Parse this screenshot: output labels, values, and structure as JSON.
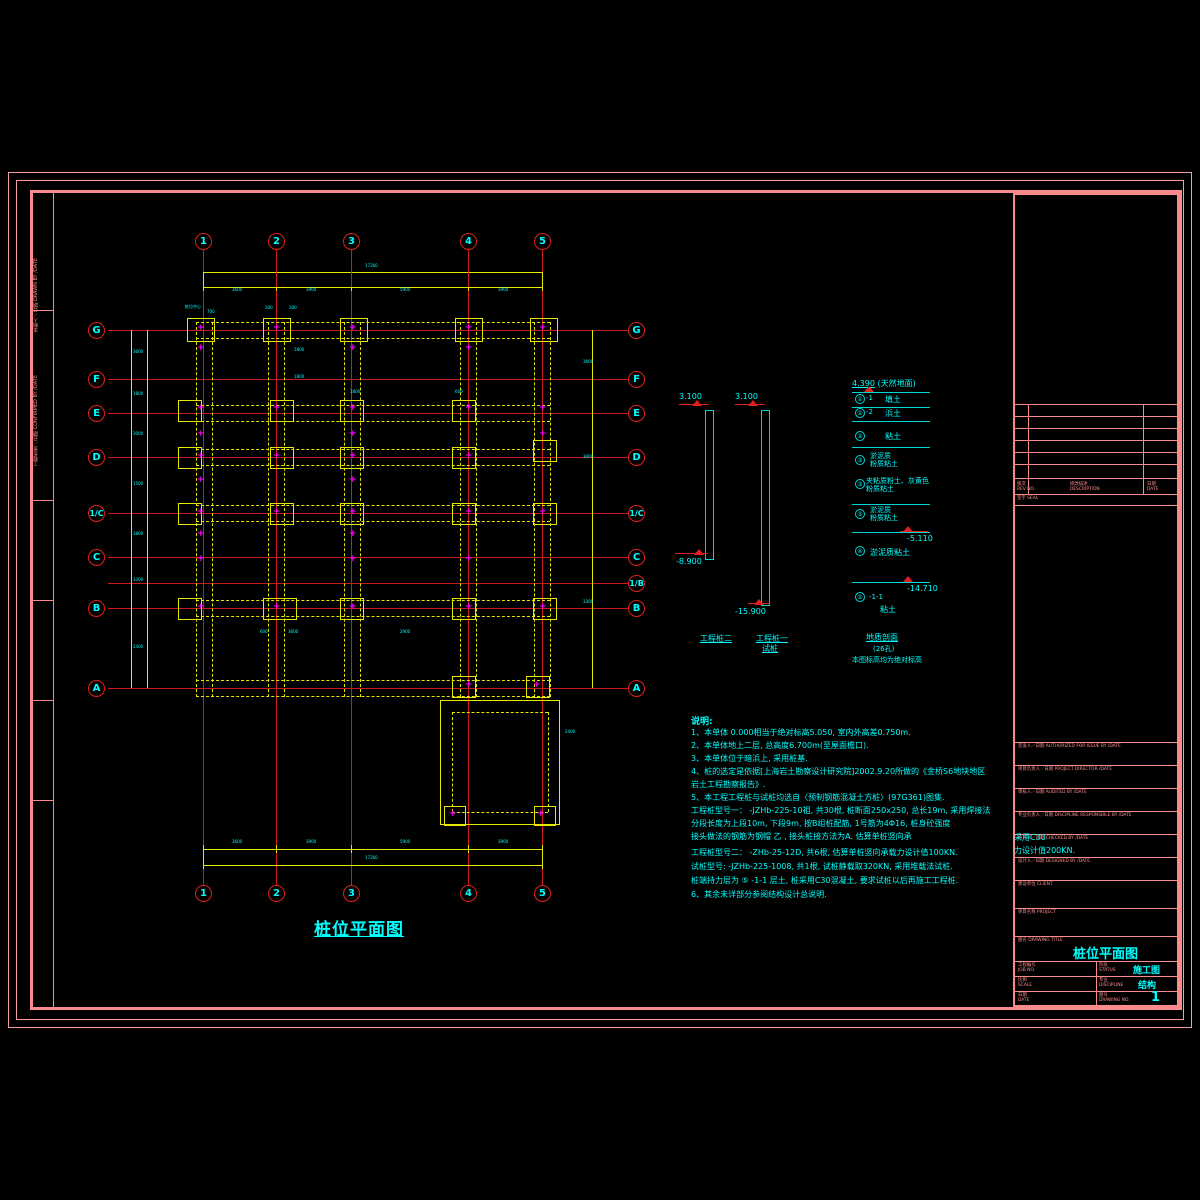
{
  "sheet": {
    "background": "#000000",
    "line_color": "#fb8b8b",
    "grid_color": "#cc1b1b",
    "dim_color": "#e8e800",
    "text_color": "#00ffff",
    "pile_color": "#ff00ff"
  },
  "left_margin": [
    {
      "cn": "本制人／日期",
      "en": "DRAWN BY /DATE"
    },
    {
      "cn": "工程负责／日期",
      "en": "CONFIRMED BY /DATE"
    }
  ],
  "plan": {
    "title": "桩位平面图",
    "grid_top": [
      "1",
      "2",
      "3",
      "4",
      "5"
    ],
    "grid_bottom": [
      "1",
      "2",
      "3",
      "4",
      "5"
    ],
    "grid_left": [
      "G",
      "F",
      "E",
      "D",
      "1/C",
      "C",
      "B",
      "A"
    ],
    "grid_right": [
      "G",
      "F",
      "E",
      "D",
      "1/C",
      "C",
      "1/B",
      "B",
      "A"
    ],
    "dim_top_overall": "17300",
    "dim_bottom_chain": [
      "3600",
      "3900",
      "5900",
      "3900"
    ],
    "dim_bottom_overall": "17300",
    "dim_left_chain": [
      "3600",
      "1800",
      "3000",
      "1500",
      "1800",
      "3300",
      "2400"
    ],
    "dim_notes": [
      "700",
      "300",
      "1800",
      "1800",
      "1800",
      "600",
      "600",
      "3600",
      "2900"
    ],
    "label_pile_mark": "桩位中心"
  },
  "sections": [
    {
      "name": "工程桩二",
      "sub": "",
      "top_elev": "3.100",
      "bottom_elev": "-8.900"
    },
    {
      "name": "工程桩一",
      "sub": "试桩",
      "top_elev": "3.100",
      "bottom_elev": "-15.900"
    }
  ],
  "geology": {
    "title": "地质剖面",
    "subtitle": "(26孔)",
    "footnote": "本图标高均为绝对标高",
    "ground_elev": "4.390",
    "ground_label": "(天然地面)",
    "layers": [
      {
        "num": "①",
        "sub": "-1",
        "name": "填土"
      },
      {
        "num": "①",
        "sub": "-2",
        "name": "浜土"
      },
      {
        "num": "②",
        "sub": "",
        "name": "粘土"
      },
      {
        "num": "③",
        "sub": "",
        "name": "淤泥质\n粉质粘土"
      },
      {
        "num": "③",
        "sub": "夹",
        "name": "夹粘质粉土、灰黄色\n粉质粘土"
      },
      {
        "num": "③",
        "sub": "",
        "name": "淤泥质\n粉质粘土"
      },
      {
        "num": "④",
        "sub": "",
        "name": "淤泥质粘土"
      },
      {
        "num": "⑤",
        "sub": "-1-1",
        "name": "粘土"
      }
    ],
    "marked_elevs": [
      "-5.110",
      "-14.710"
    ]
  },
  "notes": {
    "heading": "说明:",
    "items": [
      "1、本单体  0.000相当于绝对标高5.050, 室内外高差0.750m.",
      "2、本单体地上二层, 总高度6.700m(至屋面檐口).",
      "3、本单体位于暗浜上, 采用桩基.",
      "4、桩的选定是依据[上海岩土勘察设计研究院]2002.9.20所做的《金桥S6地块地区",
      "    岩土工程勘察报告》.",
      "5、本工程工程桩与试桩均选自〈预制钢筋混凝土方桩〉(97G361)图集.",
      "    工程桩型号一：   -JZHb-225-10祖, 共30根, 桩断面250x250, 总长19m, 采用焊接法",
      "                  分段长度为上段10m, 下段9m, 按B组桩配筋, 1号筋为4Φ16, 桩身砼强度",
      "                  接头做法的钢筋为钢帽  乙 , 接头桩接方法为A. 估算单桩竖向承",
      "    工程桩型号二：   -ZHb-25-12D, 共6根, 估算单桩竖向承载力设计值100KN.",
      "     试桩型号:   -JZHb-225-1008, 共1根, 试桩静载取320KN, 采用堆载法试桩.",
      "    桩端持力层为 ⑤ -1-1 层土, 桩采用C30混凝土, 要求试桩以后再施工工程桩.",
      "6、其余未详部分参阅结构设计总说明."
    ]
  },
  "title_block": {
    "revision_header": {
      "no_cn": "版次",
      "no_en": "REV NO.",
      "desc_cn": "修改描述",
      "desc_en": "DESCRIPTION",
      "date_cn": "日期",
      "date_en": "DATE"
    },
    "seal_label": {
      "cn": "签字",
      "en": "SEAL"
    },
    "rows": [
      {
        "cn": "签发人／日期",
        "en": "AUTHORIZED FOR ISSUE BY /DATE",
        "value": ""
      },
      {
        "cn": "项目负责人／日期",
        "en": "PROJECT DIRECTOR /DATE",
        "value": ""
      },
      {
        "cn": "审核人／日期",
        "en": "AUDITED BY /DATE",
        "value": ""
      },
      {
        "cn": "专业负责人／日期",
        "en": "DISCIPLINE RESPONSIBLE BY /DATE",
        "value": ""
      },
      {
        "cn": "校对人／日期",
        "en": "CHECKED BY /DATE",
        "value": ""
      },
      {
        "cn": "设计人／日期",
        "en": "DESIGNED BY /DATE",
        "value": ""
      },
      {
        "cn": "建设单位",
        "en": "CLIENT",
        "value": ""
      },
      {
        "cn": "项目名称",
        "en": "PROJECT",
        "value": ""
      }
    ],
    "drawing_title_label": {
      "cn": "图名",
      "en": "DRAWING TITLE"
    },
    "drawing_title": "桩位平面图",
    "footer": [
      {
        "cn": "工程编号",
        "en": "JOB NO.",
        "value": ""
      },
      {
        "cn": "阶段",
        "en": "STATUS",
        "value": "施工图"
      },
      {
        "cn": "比例",
        "en": "SCALE",
        "value": ""
      },
      {
        "cn": "专业",
        "en": "DISCIPLINE",
        "value": "结构"
      },
      {
        "cn": "日期",
        "en": "DATE",
        "value": ""
      },
      {
        "cn": "图号",
        "en": "DRAWING NO.",
        "value": "1"
      }
    ],
    "overlay_text": [
      "采用C30",
      "力设计值200KN."
    ]
  }
}
